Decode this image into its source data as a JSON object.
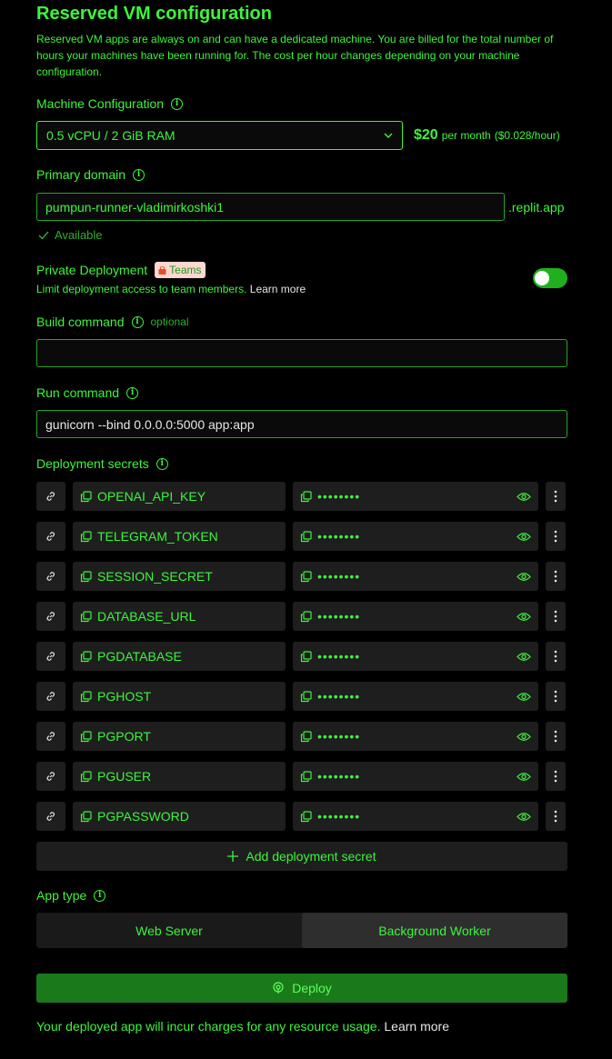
{
  "header": {
    "title": "Reserved VM configuration",
    "description": "Reserved VM apps are always on and can have a dedicated machine. You are billed for the total number of hours your machines have been running for. The cost per hour changes depending on your machine configuration."
  },
  "machine": {
    "label": "Machine Configuration",
    "selected": "0.5 vCPU / 2 GiB RAM",
    "price": "$20",
    "per_month": "per month",
    "per_hour": "($0.028/hour)"
  },
  "domain": {
    "label": "Primary domain",
    "value": "pumpun-runner-vladimirkoshki1",
    "suffix": ".replit.app",
    "status": "Available"
  },
  "private": {
    "label": "Private Deployment",
    "badge": "Teams",
    "hint": "Limit deployment access to team members.",
    "learn_more": "Learn more",
    "enabled": true
  },
  "build": {
    "label": "Build command",
    "optional": "optional",
    "value": ""
  },
  "run": {
    "label": "Run command",
    "value": "gunicorn --bind 0.0.0.0:5000 app:app"
  },
  "secrets": {
    "label": "Deployment secrets",
    "masked": "••••••••",
    "items": [
      {
        "key": "OPENAI_API_KEY"
      },
      {
        "key": "TELEGRAM_TOKEN"
      },
      {
        "key": "SESSION_SECRET"
      },
      {
        "key": "DATABASE_URL"
      },
      {
        "key": "PGDATABASE"
      },
      {
        "key": "PGHOST"
      },
      {
        "key": "PGPORT"
      },
      {
        "key": "PGUSER"
      },
      {
        "key": "PGPASSWORD"
      }
    ],
    "add_label": "Add deployment secret"
  },
  "app_type": {
    "label": "App type",
    "options": [
      "Web Server",
      "Background Worker"
    ],
    "selected": "Background Worker"
  },
  "deploy": {
    "label": "Deploy"
  },
  "footer": {
    "text": "Your deployed app will incur charges for any resource usage.",
    "learn_more": "Learn more"
  },
  "colors": {
    "accent": "#3cf53c",
    "deploy_bg": "#1a7a1a",
    "toggle_on": "#1fb01f",
    "badge_bg": "#ffd7d0"
  }
}
